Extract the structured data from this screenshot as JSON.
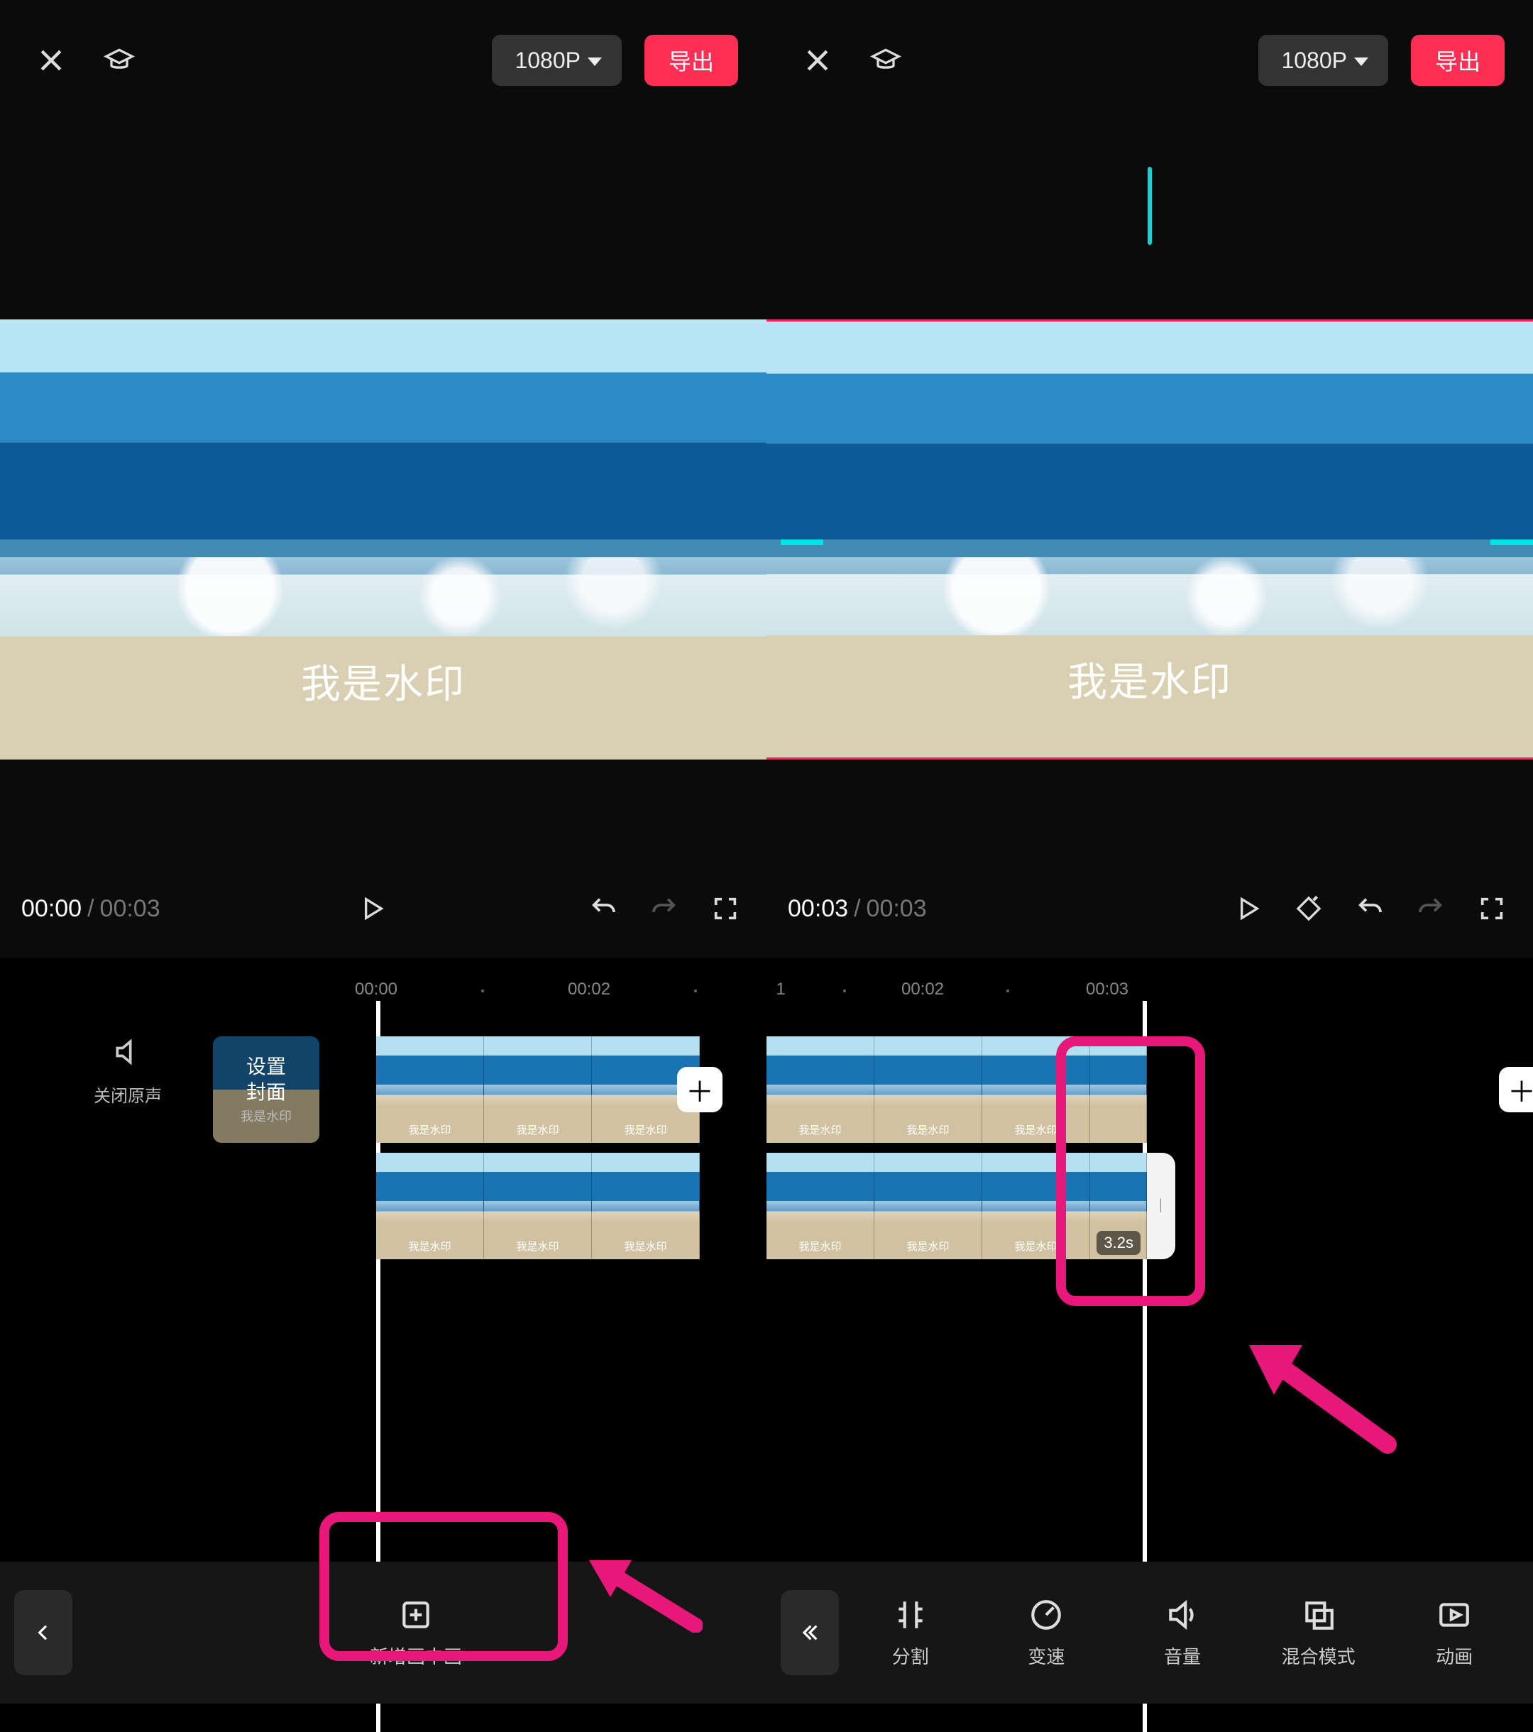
{
  "header": {
    "resolution_label": "1080P",
    "export_label": "导出"
  },
  "preview": {
    "watermark_text": "我是水印"
  },
  "time": {
    "left_current": "00:00",
    "left_total": "00:03",
    "right_current": "00:03",
    "right_total": "00:03",
    "separator": "/"
  },
  "ruler": {
    "t0": "00:00",
    "t1": "00:02",
    "t2": "1",
    "t3": "00:02",
    "t4": "00:03"
  },
  "timeline": {
    "mute_label": "关闭原声",
    "cover_label": "设置\n封面",
    "cover_sub": "我是水印",
    "clip_watermark": "我是水印",
    "duration_badge": "3.2s"
  },
  "bottom_left": {
    "new_pip_label": "新增画中画"
  },
  "bottom_right": {
    "tools": [
      {
        "id": "split",
        "label": "分割"
      },
      {
        "id": "speed",
        "label": "变速"
      },
      {
        "id": "volume",
        "label": "音量"
      },
      {
        "id": "blend",
        "label": "混合模式"
      },
      {
        "id": "anim",
        "label": "动画"
      }
    ]
  },
  "icons": {
    "close": "close-icon",
    "academy": "graduation-cap-icon",
    "play": "play-icon",
    "undo": "undo-icon",
    "redo": "redo-icon",
    "fullscreen": "fullscreen-icon",
    "keyframe": "keyframe-icon",
    "back": "chevron-left-icon",
    "back2": "chevron-double-left-icon",
    "speaker": "speaker-icon",
    "plus": "plus-icon",
    "split": "split-icon",
    "speed": "speed-icon",
    "volume": "volume-icon",
    "blend": "blend-icon",
    "anim": "animation-icon",
    "addpip": "add-square-icon"
  }
}
